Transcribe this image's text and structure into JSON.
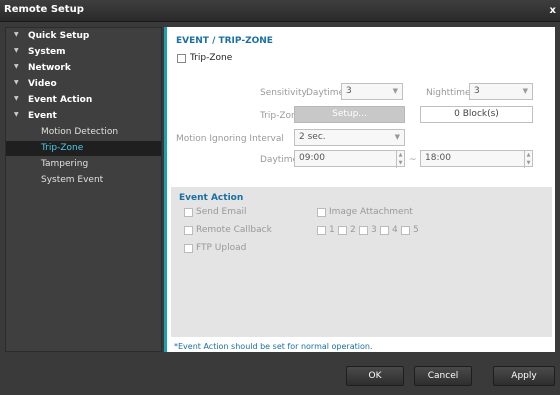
{
  "window": {
    "title": "Remote Setup",
    "close_label": "x"
  },
  "sidebar": {
    "groups": [
      {
        "label": "Quick Setup"
      },
      {
        "label": "System"
      },
      {
        "label": "Network"
      },
      {
        "label": "Video"
      },
      {
        "label": "Event Action"
      },
      {
        "label": "Event"
      }
    ],
    "event_items": [
      {
        "label": "Motion Detection"
      },
      {
        "label": "Trip-Zone"
      },
      {
        "label": "Tampering"
      },
      {
        "label": "System Event"
      }
    ],
    "active_item": "Trip-Zone"
  },
  "main": {
    "section_title": "EVENT / TRIP-ZONE",
    "enable_label": "Trip-Zone",
    "sensitivity_label": "Sensitivity",
    "daytime_label": "Daytime",
    "daytime_value": "3",
    "nighttime_label": "Nighttime",
    "nighttime_value": "3",
    "tripzone_label": "Trip-Zone",
    "setup_button": "Setup...",
    "blocks_value": "0 Block(s)",
    "motion_ignore_label": "Motion Ignoring Interval",
    "motion_ignore_value": "2 sec.",
    "daytime_range_label": "Daytime",
    "daytime_start": "09:00",
    "range_sep": "~",
    "daytime_end": "18:00"
  },
  "event_action": {
    "heading": "Event Action",
    "send_email": "Send Email",
    "image_attachment": "Image Attachment",
    "remote_callback": "Remote Callback",
    "callback_numbers": [
      "1",
      "2",
      "3",
      "4",
      "5"
    ],
    "ftp_upload": "FTP Upload"
  },
  "note": "*Event Action should be set for normal operation.",
  "footer": {
    "ok": "OK",
    "cancel": "Cancel",
    "apply": "Apply"
  }
}
